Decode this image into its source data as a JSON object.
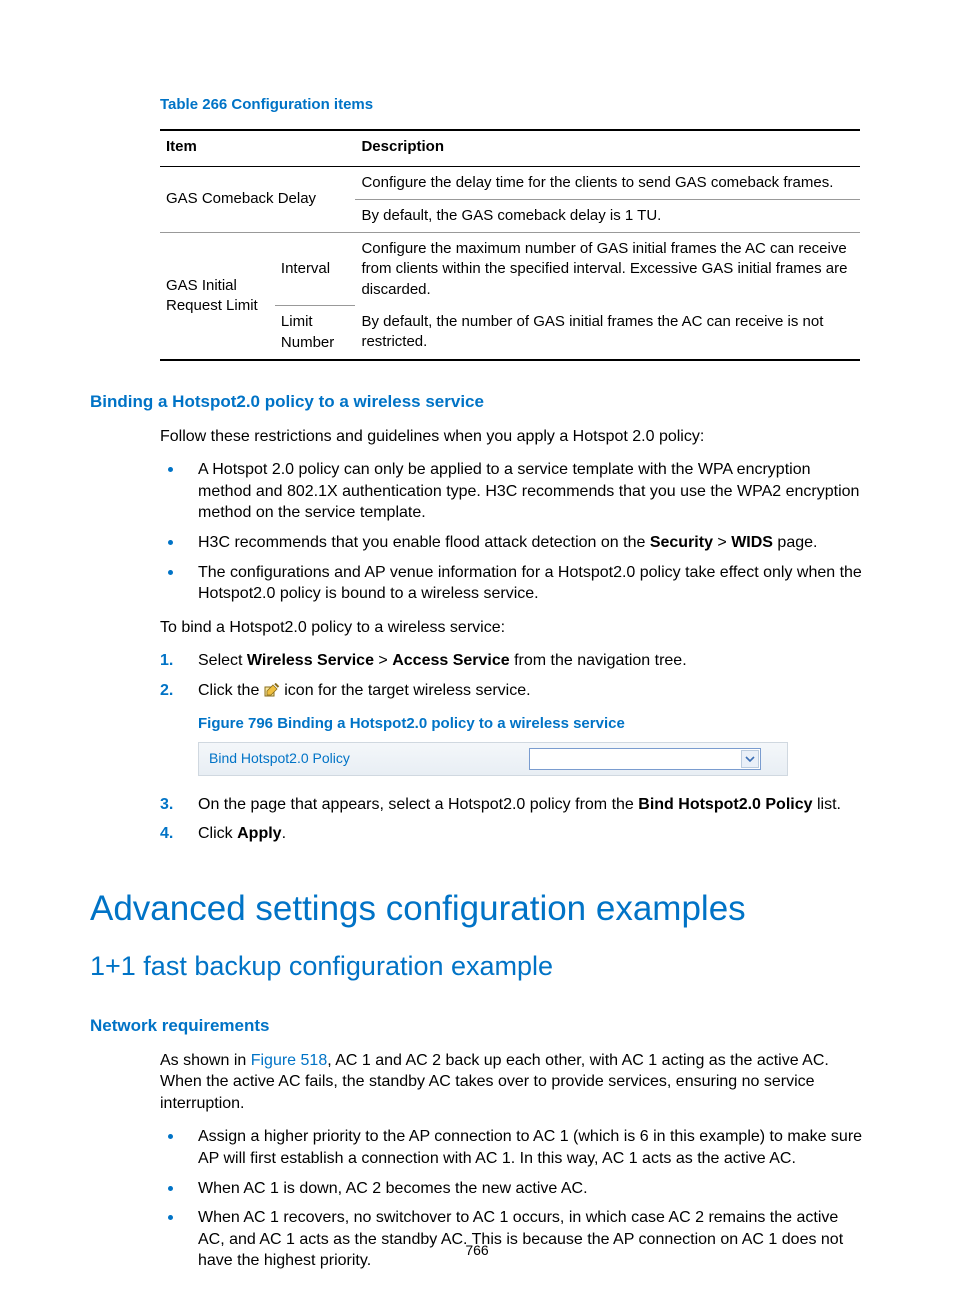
{
  "table": {
    "caption": "Table 266 Configuration items",
    "headers": {
      "item": "Item",
      "desc": "Description"
    },
    "r1_item": "GAS Comeback Delay",
    "r1_desc_a": "Configure the delay time for the clients to send GAS comeback frames.",
    "r1_desc_b": "By default, the GAS comeback delay is 1 TU.",
    "r2_item": "GAS Initial Request Limit",
    "r2_sub_a": "Interval",
    "r2_sub_b": "Limit Number",
    "r2_desc_a": "Configure the maximum number of GAS initial frames the AC can receive from clients within the specified interval. Excessive GAS initial frames are discarded.",
    "r2_desc_b": "By default, the number of GAS initial frames the AC can receive is not restricted."
  },
  "sec1": {
    "heading": "Binding a Hotspot2.0 policy to a wireless service",
    "intro": "Follow these restrictions and guidelines when you apply a Hotspot 2.0 policy:",
    "b1": "A Hotspot 2.0 policy can only be applied to a service template with the WPA encryption method and 802.1X authentication type. H3C recommends that you use the WPA2 encryption method on the service template.",
    "b2_pre": "H3C recommends that you enable flood attack detection on the ",
    "b2_bold1": "Security",
    "b2_gt": " > ",
    "b2_bold2": "WIDS",
    "b2_post": " page.",
    "b3": "The configurations and AP venue information for a Hotspot2.0 policy take effect only when the Hotspot2.0 policy is bound to a wireless service.",
    "lead2": "To bind a Hotspot2.0 policy to a wireless service:",
    "s1_pre": "Select ",
    "s1_b1": "Wireless Service",
    "s1_mid": " > ",
    "s1_b2": "Access Service",
    "s1_post": " from the navigation tree.",
    "s2_pre": "Click the ",
    "s2_post": " icon for the target wireless service.",
    "fig_caption": "Figure 796 Binding a Hotspot2.0 policy to a wireless service",
    "fig_label": "Bind Hotspot2.0 Policy",
    "s3_pre": "On the page that appears, select a Hotspot2.0 policy from the ",
    "s3_bold": "Bind Hotspot2.0 Policy",
    "s3_post": " list.",
    "s4_pre": "Click ",
    "s4_bold": "Apply",
    "s4_post": "."
  },
  "h1": "Advanced settings configuration examples",
  "h2": "1+1 fast backup configuration example",
  "sec2": {
    "heading": "Network requirements",
    "p_pre": "As shown in ",
    "p_ref": "Figure 518",
    "p_post": ", AC 1 and AC 2 back up each other, with AC 1 acting as the active AC. When the active AC fails, the standby AC takes over to provide services, ensuring no service interruption.",
    "b1": "Assign a higher priority to the AP connection to AC 1 (which is 6 in this example) to make sure AP will first establish a connection with AC 1. In this way, AC 1 acts as the active AC.",
    "b2": "When AC 1 is down, AC 2 becomes the new active AC.",
    "b3": "When AC 1 recovers, no switchover to AC 1 occurs, in which case AC 2 remains the active AC, and AC 1 acts as the standby AC. This is because the AP connection on AC 1 does not have the highest priority."
  },
  "page_number": "766"
}
